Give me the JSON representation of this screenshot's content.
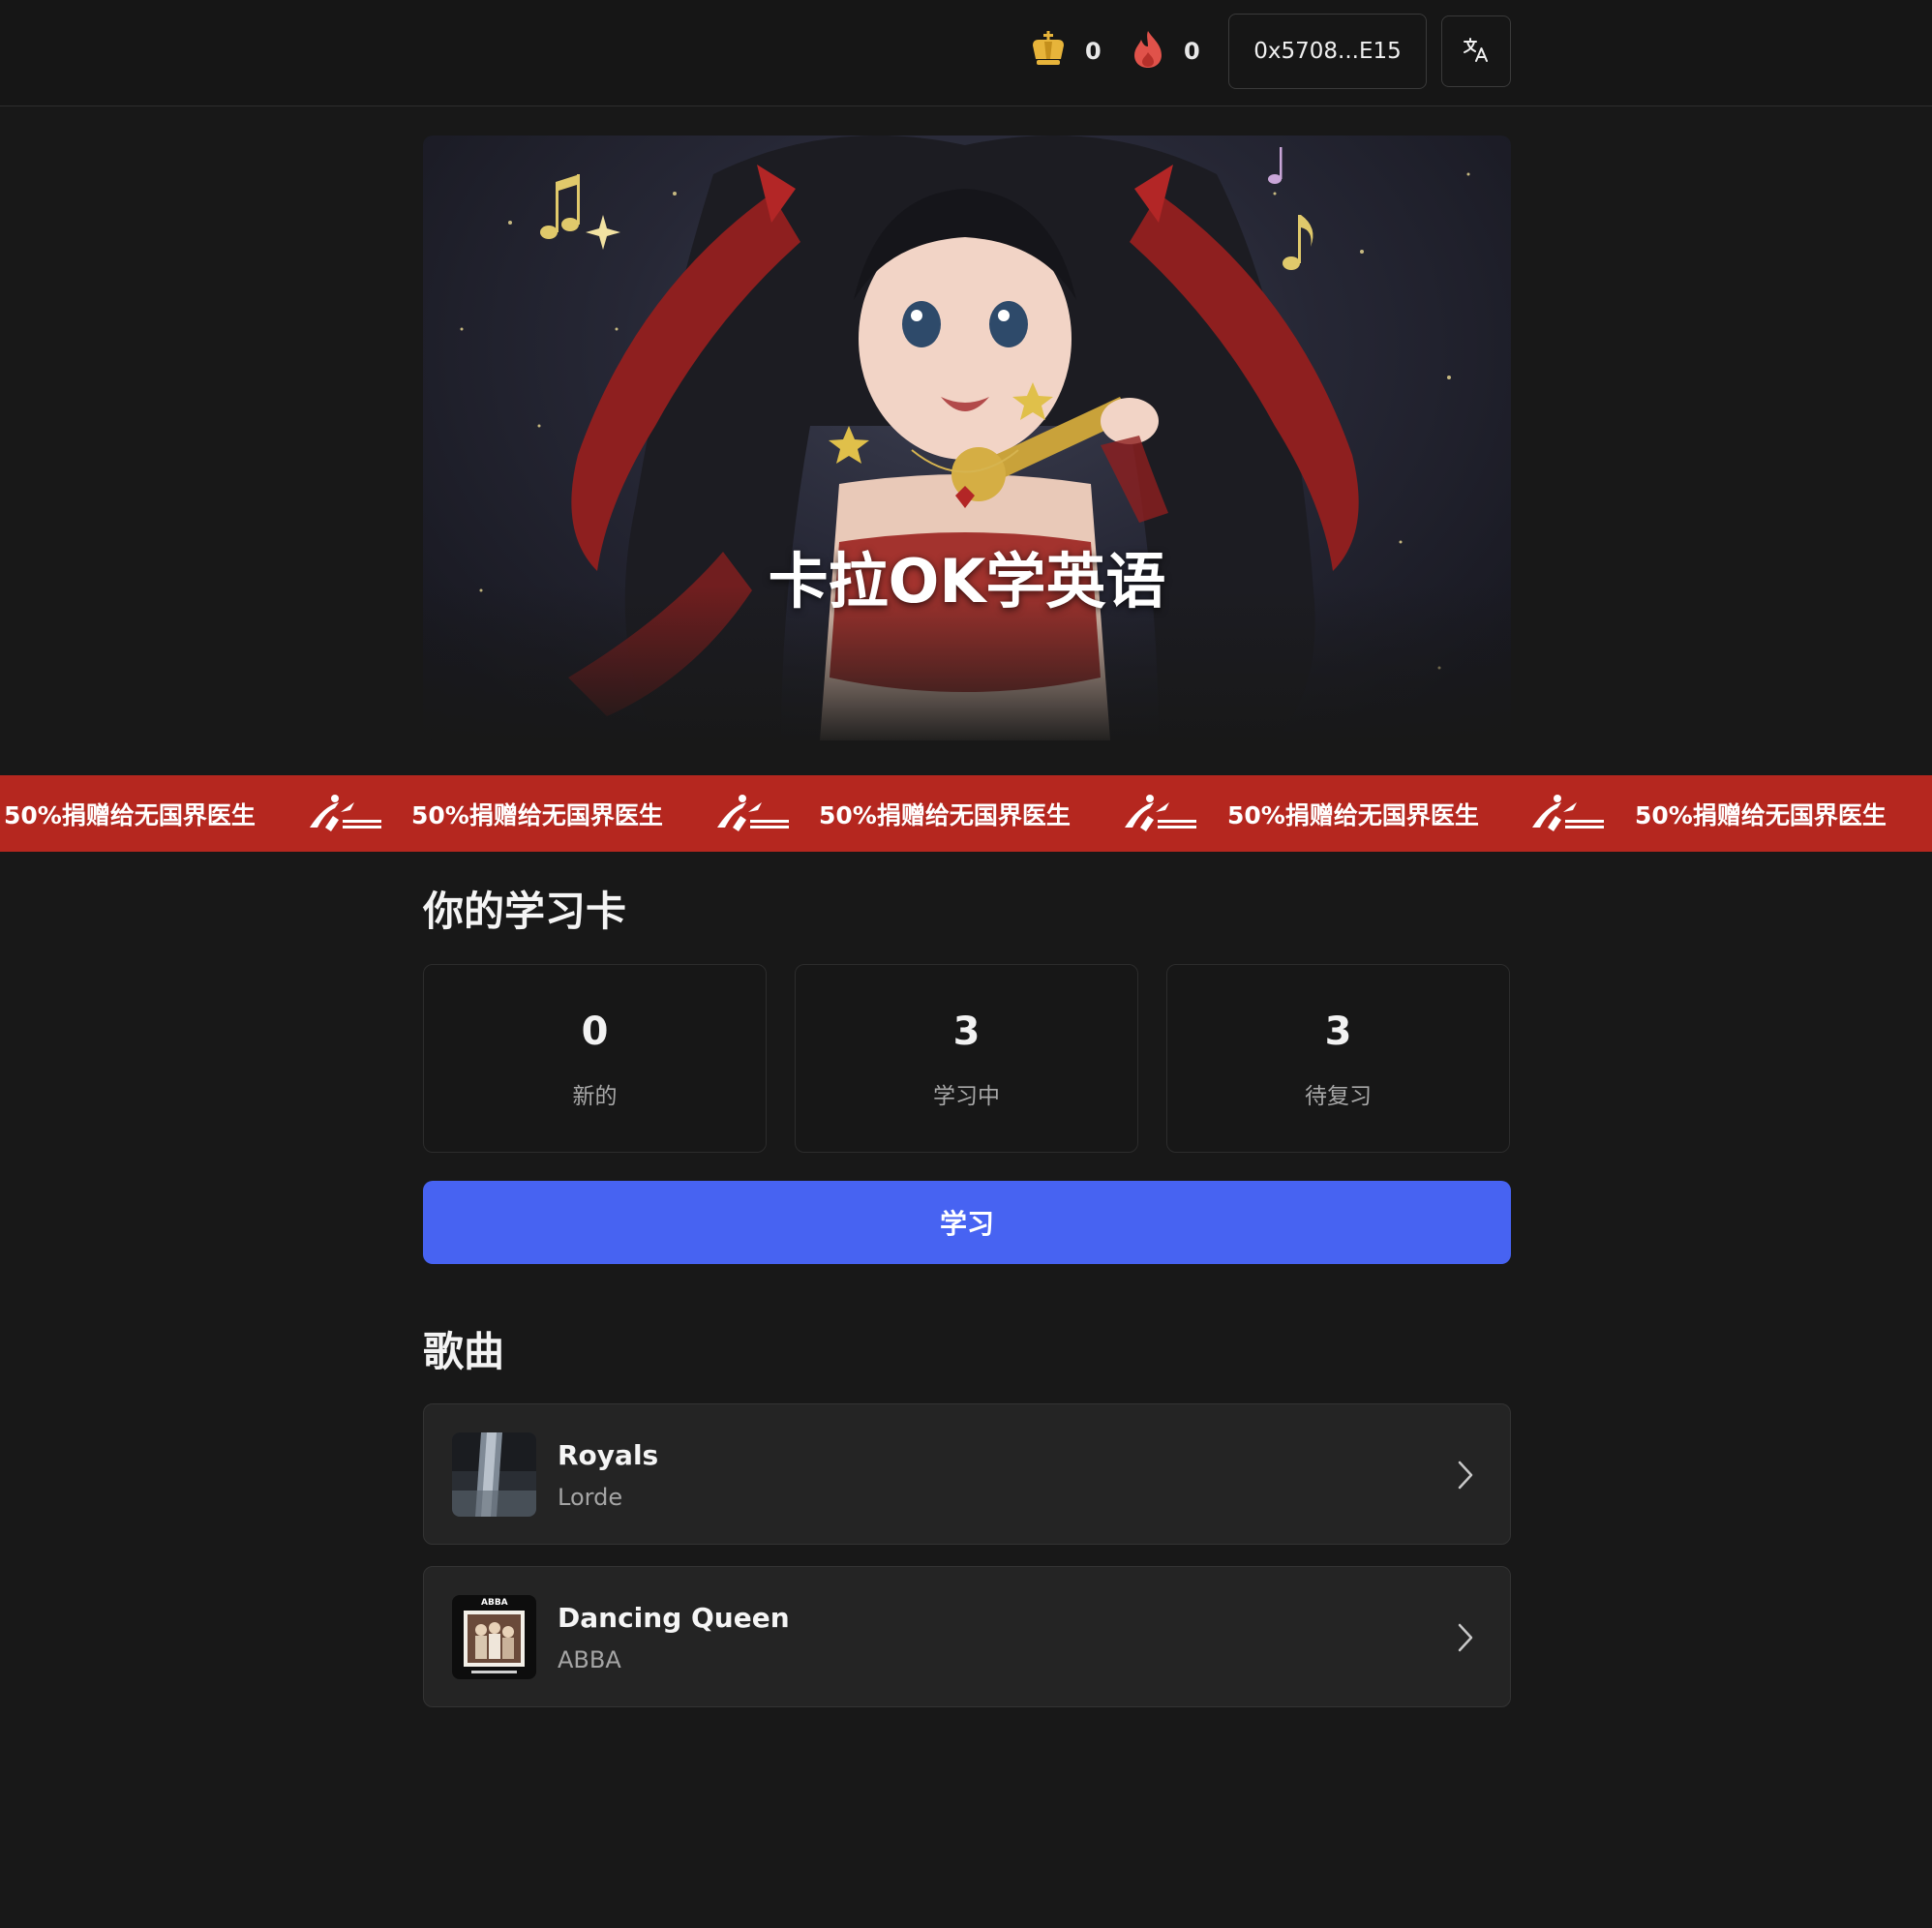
{
  "header": {
    "crown_count": "0",
    "streak_count": "0",
    "wallet_address": "0x5708...E15",
    "crown_icon": "crown-icon",
    "flame_icon": "flame-icon",
    "language_icon": "translate-icon"
  },
  "hero": {
    "title": "卡拉OK学英语"
  },
  "banner": {
    "text": "50%捐赠给无国界医生",
    "background": "#b5271f"
  },
  "cards_section": {
    "title": "你的学习卡",
    "stats": [
      {
        "value": "0",
        "label": "新的"
      },
      {
        "value": "3",
        "label": "学习中"
      },
      {
        "value": "3",
        "label": "待复习"
      }
    ],
    "study_button": "学习",
    "accent": "#4763f2"
  },
  "songs_section": {
    "title": "歌曲",
    "songs": [
      {
        "title": "Royals",
        "artist": "Lorde"
      },
      {
        "title": "Dancing Queen",
        "artist": "ABBA",
        "cover_text": "ABBA"
      }
    ]
  }
}
